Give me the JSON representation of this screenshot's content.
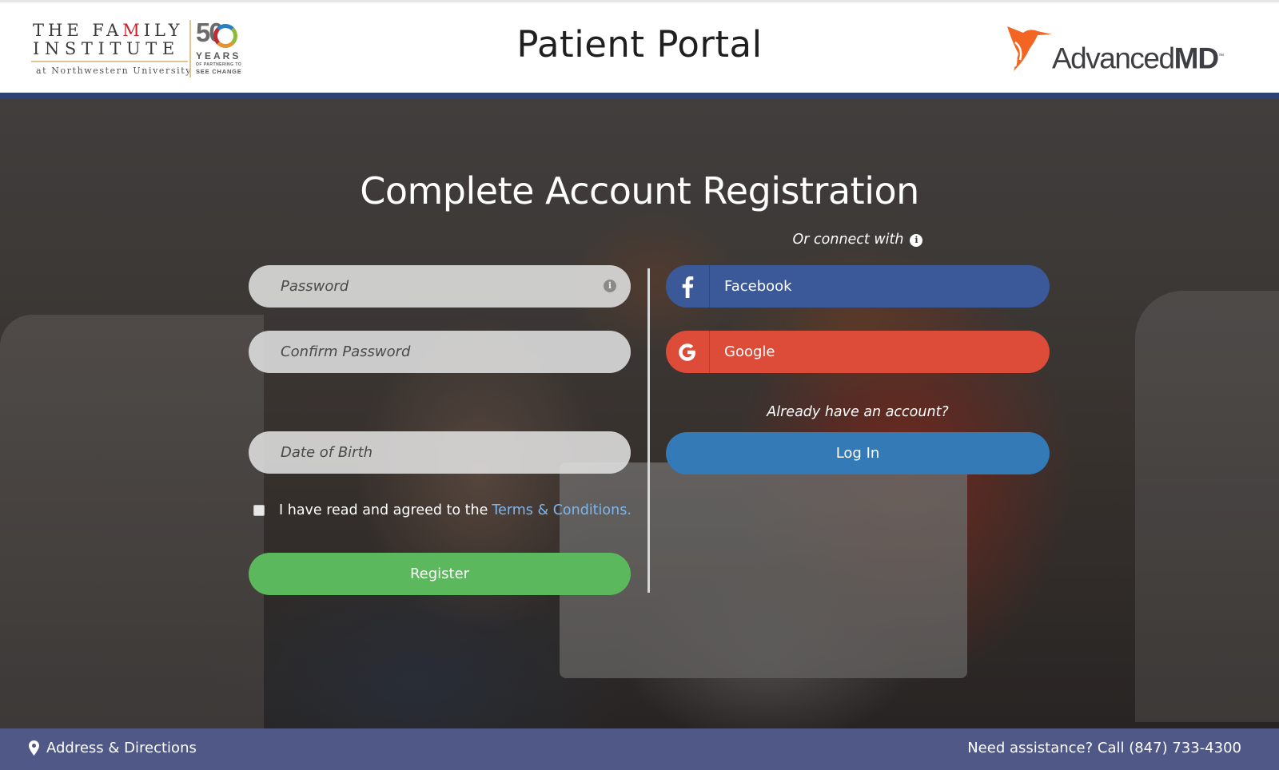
{
  "header": {
    "left_logo": {
      "line1_pre": "THE FA",
      "line1_accent": "M",
      "line1_post": "ILY",
      "line2": "INSTITUTE",
      "line3": "at Northwestern University",
      "anniversary_number": "50",
      "anniversary_word": "YEARS",
      "anniversary_tagline_small": "OF PARTNERING TO",
      "anniversary_tagline": "SEE CHANGE"
    },
    "title": "Patient Portal",
    "right_logo": {
      "brand_light": "Advanced",
      "brand_bold": "MD",
      "trademark": "™"
    }
  },
  "main": {
    "heading": "Complete Account Registration",
    "form": {
      "password_placeholder": "Password",
      "confirm_password_placeholder": "Confirm Password",
      "dob_placeholder": "Date of Birth",
      "terms_text": "I have read and agreed to the",
      "terms_link": "Terms & Conditions.",
      "terms_checked": false,
      "register_label": "Register"
    },
    "social": {
      "connect_label": "Or connect with",
      "facebook_label": "Facebook",
      "google_label": "Google",
      "already_label": "Already have an account?",
      "login_label": "Log In"
    }
  },
  "footer": {
    "address_label": "Address & Directions",
    "assistance_label": "Need assistance? Call (847) 733-4300"
  },
  "colors": {
    "header_rule": "#2e4275",
    "facebook": "#3b5998",
    "google": "#dd4b39",
    "login": "#337ab7",
    "register": "#5cb85c",
    "terms_link": "#7cb6ee",
    "footer": "#505888",
    "advancedmd_orange": "#f26522"
  }
}
